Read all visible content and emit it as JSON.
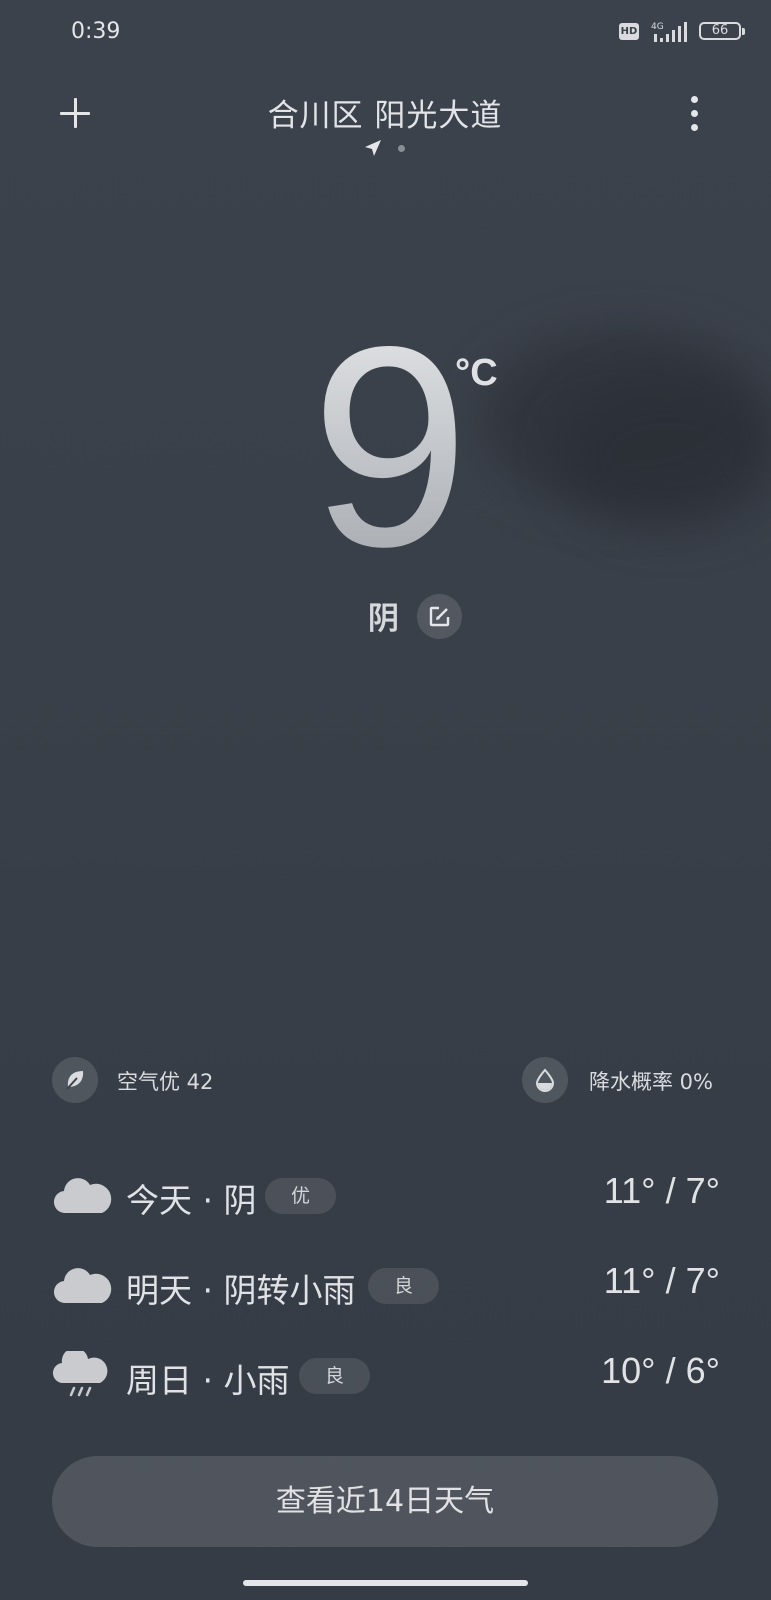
{
  "status_bar": {
    "time": "0:39",
    "hd": "HD",
    "network": "4G",
    "battery": "66"
  },
  "header": {
    "location": "合川区 阳光大道",
    "add_icon": "plus-icon",
    "more_icon": "more-vertical-icon",
    "location_icon": "navigation-arrow-icon"
  },
  "current": {
    "temperature": "9",
    "unit": "°C",
    "condition": "阴",
    "edit_icon": "edit-icon"
  },
  "info": {
    "air_quality": "空气优 42",
    "precipitation": "降水概率 0%"
  },
  "forecast": [
    {
      "icon": "cloudy-icon",
      "label": "今天 · 阴",
      "badge": "优",
      "temps": "11° / 7°"
    },
    {
      "icon": "cloudy-icon",
      "label": "明天 · 阴转小雨",
      "badge": "良",
      "temps": "11° / 7°"
    },
    {
      "icon": "light-rain-icon",
      "label": "周日 · 小雨",
      "badge": "良",
      "temps": "10° / 6°"
    }
  ],
  "forecast_button_label": "查看近14日天气",
  "colors": {
    "background": "#3a4049",
    "text": "#e0e2e5",
    "chip": "rgba(255,255,255,0.13)"
  }
}
